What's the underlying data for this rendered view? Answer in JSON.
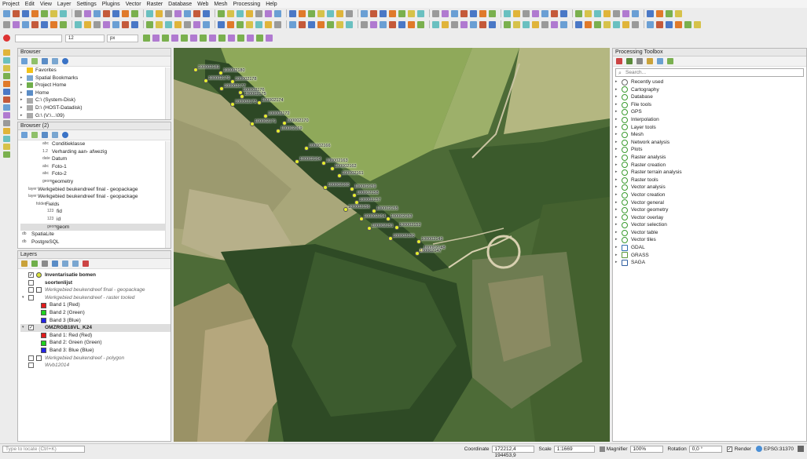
{
  "menu": [
    "Project",
    "Edit",
    "View",
    "Layer",
    "Settings",
    "Plugins",
    "Vector",
    "Raster",
    "Database",
    "Web",
    "Mesh",
    "Processing",
    "Help"
  ],
  "toolbar3": {
    "font_size": "12",
    "unit": "px"
  },
  "browser": {
    "title": "Browser",
    "items": [
      "Favorites",
      "Spatial Bookmarks",
      "Project Home",
      "Home",
      "C:\\ (System-Disk)",
      "D:\\ (HOST-Datadisk)",
      "G:\\ (V:\\...\\09)"
    ]
  },
  "browser2": {
    "title": "Browser (2)",
    "items": [
      {
        "type": "abc",
        "label": "Conditieklasse"
      },
      {
        "type": "1.2",
        "label": "Verharding aan- afwezig"
      },
      {
        "type": "date",
        "label": "Datum"
      },
      {
        "type": "abc",
        "label": "Foto-1"
      },
      {
        "type": "abc",
        "label": "Foto-2"
      },
      {
        "type": "geom",
        "label": "geometry"
      },
      {
        "type": "layer",
        "label": "Werkgebied beukendreef final - geopackage"
      },
      {
        "type": "layer",
        "label": "Werkgebied beukendreef final - geopackage"
      },
      {
        "type": "folder",
        "label": "Fields"
      },
      {
        "type": "123",
        "label": "fid"
      },
      {
        "type": "123",
        "label": "id"
      },
      {
        "type": "geom",
        "label": "geom"
      },
      {
        "type": "db",
        "label": "SpatiaLite"
      },
      {
        "type": "db",
        "label": "PostgreSQL"
      }
    ]
  },
  "layers": {
    "title": "Layers",
    "items": [
      {
        "label": "Inventarisatie bomen",
        "style": "bold",
        "checked": true,
        "color": "#d8e23a"
      },
      {
        "label": "soortenlijst",
        "style": "bold",
        "checked": false,
        "color": ""
      },
      {
        "label": "Werkgebied beukendreef final - geopackage",
        "style": "italic",
        "checked": false,
        "color": "#ffffff"
      },
      {
        "label": "Werkgebied beukendreef - raster tooled",
        "style": "italic",
        "checked": false,
        "color": ""
      },
      {
        "label": "Band 1 (Red)",
        "style": "normal",
        "checked": false,
        "color": "#e11c1c"
      },
      {
        "label": "Band 2 (Green)",
        "style": "normal",
        "checked": false,
        "color": "#1fd11f"
      },
      {
        "label": "Band 3 (Blue)",
        "style": "normal",
        "checked": false,
        "color": "#2424e6"
      },
      {
        "label": "OMZRGB18VL_K24",
        "style": "bold",
        "checked": true,
        "color": ""
      },
      {
        "label": "Band 1: Red (Red)",
        "style": "normal",
        "checked": false,
        "color": "#e11c1c"
      },
      {
        "label": "Band 2: Green (Green)",
        "style": "normal",
        "checked": false,
        "color": "#1fd11f"
      },
      {
        "label": "Band 3: Blue (Blue)",
        "style": "normal",
        "checked": false,
        "color": "#2424e6"
      },
      {
        "label": "Werkgebied beukendreef - polygon",
        "style": "italic",
        "checked": false,
        "color": "#ffffff"
      },
      {
        "label": "Wvb12014",
        "style": "italic",
        "checked": false,
        "color": ""
      }
    ]
  },
  "map_labels": [
    "100002181",
    "100002180",
    "100002179",
    "100002178",
    "100002177",
    "100002176",
    "100002175",
    "100002174",
    "100002173",
    "100002172",
    "100002171",
    "100002170",
    "100002169",
    "100002166",
    "100002164",
    "100002163",
    "100002162",
    "100002161",
    "100002160",
    "100002159",
    "100002158",
    "100002157",
    "100002156",
    "100002155",
    "100002154",
    "100002153",
    "100002152",
    "100002151",
    "100002150",
    "100002149",
    "100002148",
    "100002147"
  ],
  "processing": {
    "title": "Processing Toolbox",
    "search_placeholder": "Search...",
    "items": [
      "Recently used",
      "Cartography",
      "Database",
      "File tools",
      "GPS",
      "Interpolation",
      "Layer tools",
      "Mesh",
      "Network analysis",
      "Plots",
      "Raster analysis",
      "Raster creation",
      "Raster terrain analysis",
      "Raster tools",
      "Vector analysis",
      "Vector creation",
      "Vector general",
      "Vector geometry",
      "Vector overlay",
      "Vector selection",
      "Vector table",
      "Vector tiles",
      "GDAL",
      "GRASS",
      "SAGA"
    ]
  },
  "status": {
    "locate_placeholder": "Type to locate (Ctrl+K)",
    "coordinate_label": "Coordinate",
    "coordinate": "172212,4 194453,9",
    "scale_label": "Scale",
    "scale": "1:1669",
    "magnifier_label": "Magnifier",
    "magnifier": "100%",
    "rotation_label": "Rotation",
    "rotation": "0,0 °",
    "render_label": "Render",
    "crs": "EPSG:31370"
  }
}
